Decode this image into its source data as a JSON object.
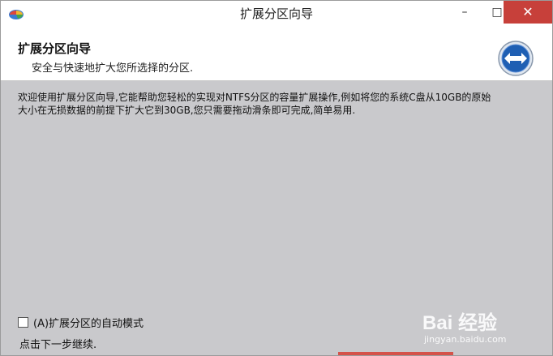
{
  "window": {
    "title": "扩展分区向导",
    "minimize_glyph": "–",
    "maximize_glyph": "□",
    "close_glyph": "✕"
  },
  "header": {
    "title": "扩展分区向导",
    "subtitle": "安全与快速地扩大您所选择的分区.",
    "icon": "left-right-arrows-icon"
  },
  "content": {
    "description": "欢迎使用扩展分区向导,它能帮助您轻松的实现对NTFS分区的容量扩展操作,例如将您的系统C盘从10GB的原始大小在无损数据的前提下扩大它到30GB,您只需要拖动滑条即可完成,简单易用.",
    "auto_mode_label": "(A)扩展分区的自动模式",
    "auto_mode_checked": false,
    "next_hint": "点击下一步继续."
  },
  "watermark": {
    "logo_text": "Bai 经验",
    "site": "jingyan.baidu.com"
  },
  "colors": {
    "content_bg": "#c9c9cc",
    "close_button": "#c7403a",
    "icon_blue": "#1f5fb3"
  }
}
